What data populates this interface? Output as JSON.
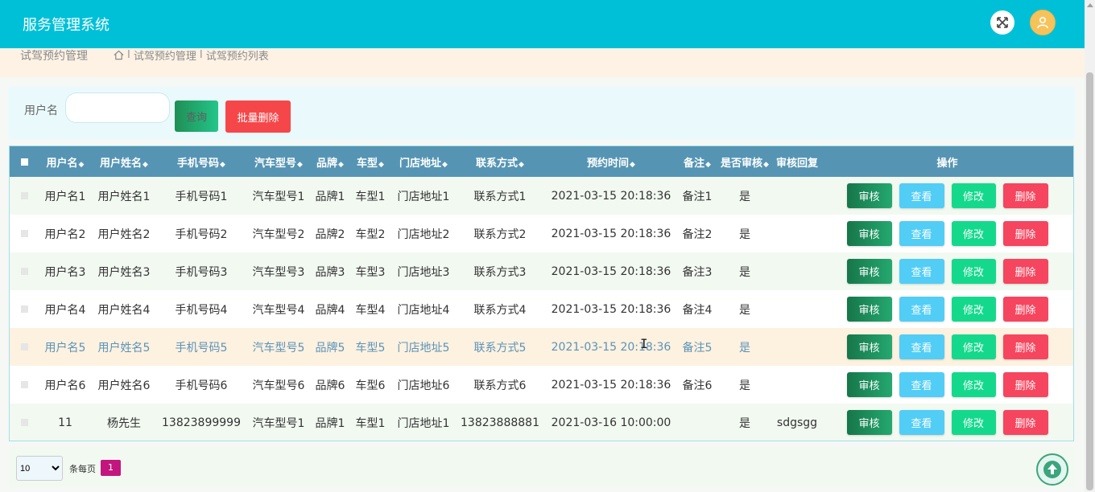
{
  "app": {
    "title": "服务管理系统"
  },
  "icons": {
    "fullscreen": "expand-arrows-icon",
    "user": "user-icon",
    "home": "home-icon",
    "back_to_top": "arrow-up-circle-icon"
  },
  "breadcrumb": {
    "module": "试驾预约管理",
    "path": [
      "试驾预约管理",
      "试驾预约列表"
    ],
    "separator": "I"
  },
  "search": {
    "label": "用户名",
    "value": "",
    "query_button": "查询",
    "batch_delete_button": "批量删除"
  },
  "table": {
    "columns": [
      "用户名",
      "用户姓名",
      "手机号码",
      "汽车型号",
      "品牌",
      "车型",
      "门店地址",
      "联系方式",
      "预约时间",
      "备注",
      "是否审核",
      "审核回复",
      "操作"
    ],
    "sort_indicator": "◆",
    "rows": [
      [
        "用户名1",
        "用户姓名1",
        "手机号码1",
        "汽车型号1",
        "品牌1",
        "车型1",
        "门店地址1",
        "联系方式1",
        "2021-03-15 20:18:36",
        "备注1",
        "是",
        ""
      ],
      [
        "用户名2",
        "用户姓名2",
        "手机号码2",
        "汽车型号2",
        "品牌2",
        "车型2",
        "门店地址2",
        "联系方式2",
        "2021-03-15 20:18:36",
        "备注2",
        "是",
        ""
      ],
      [
        "用户名3",
        "用户姓名3",
        "手机号码3",
        "汽车型号3",
        "品牌3",
        "车型3",
        "门店地址3",
        "联系方式3",
        "2021-03-15 20:18:36",
        "备注3",
        "是",
        ""
      ],
      [
        "用户名4",
        "用户姓名4",
        "手机号码4",
        "汽车型号4",
        "品牌4",
        "车型4",
        "门店地址4",
        "联系方式4",
        "2021-03-15 20:18:36",
        "备注4",
        "是",
        ""
      ],
      [
        "用户名5",
        "用户姓名5",
        "手机号码5",
        "汽车型号5",
        "品牌5",
        "车型5",
        "门店地址5",
        "联系方式5",
        "2021-03-15 20:18:36",
        "备注5",
        "是",
        ""
      ],
      [
        "用户名6",
        "用户姓名6",
        "手机号码6",
        "汽车型号6",
        "品牌6",
        "车型6",
        "门店地址6",
        "联系方式6",
        "2021-03-15 20:18:36",
        "备注6",
        "是",
        ""
      ],
      [
        "11",
        "杨先生",
        "13823899999",
        "汽车型号1",
        "品牌1",
        "车型1",
        "门店地址1",
        "13823888881",
        "2021-03-16 10:00:00",
        "",
        "是",
        "sdgsgg"
      ]
    ],
    "highlighted_row": 4,
    "actions": {
      "audit": "审核",
      "view": "查看",
      "edit": "修改",
      "delete": "删除"
    }
  },
  "pagination": {
    "page_size": "10",
    "page_size_options": [
      "10"
    ],
    "per_page_label": "条每页",
    "current_page": "1"
  },
  "colors": {
    "header": "#00c0d8",
    "table_header": "#5694b3",
    "audit": "#1f8f55",
    "view": "#52cdf5",
    "edit": "#14d98c",
    "delete": "#f6455e",
    "page_active": "#c3157e"
  }
}
